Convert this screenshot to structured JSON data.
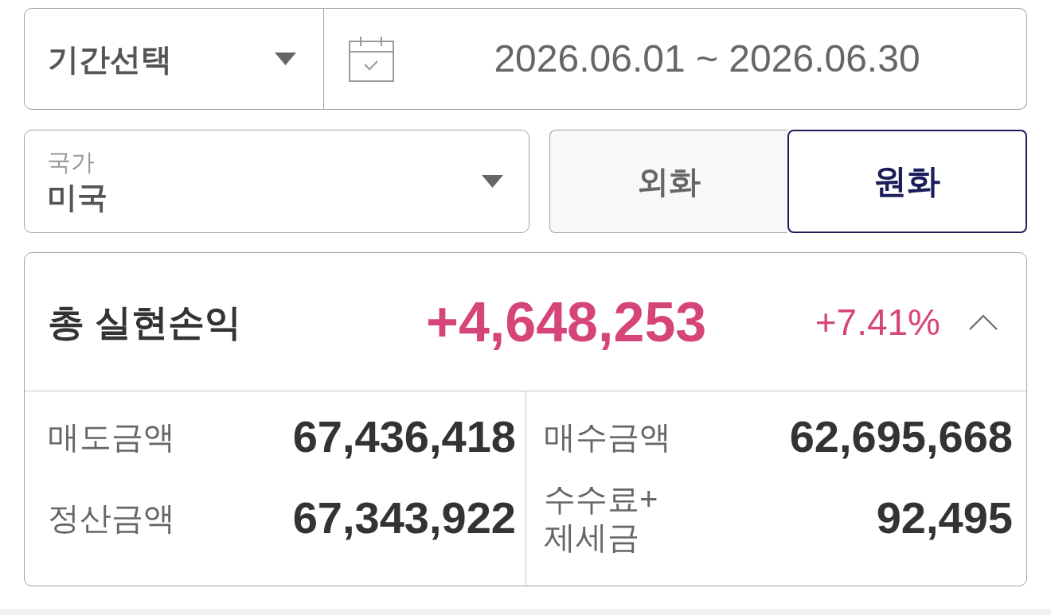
{
  "period_select": {
    "label": "기간선택"
  },
  "date_range": {
    "value": "2026.06.01 ~ 2026.06.30"
  },
  "country_select": {
    "label": "국가",
    "value": "미국"
  },
  "currency_toggle": [
    {
      "label": "외화",
      "selected": false
    },
    {
      "label": "원화",
      "selected": true
    }
  ],
  "summary": {
    "title": "총 실현손익",
    "amount": "+4,648,253",
    "rate": "+7.41%",
    "expanded": true,
    "items": [
      {
        "label": "매도금액",
        "value": "67,436,418"
      },
      {
        "label": "매수금액",
        "value": "62,695,668"
      },
      {
        "label": "정산금액",
        "value": "67,343,922"
      },
      {
        "label": "수수료+\n제세금",
        "value": "92,495"
      }
    ]
  }
}
